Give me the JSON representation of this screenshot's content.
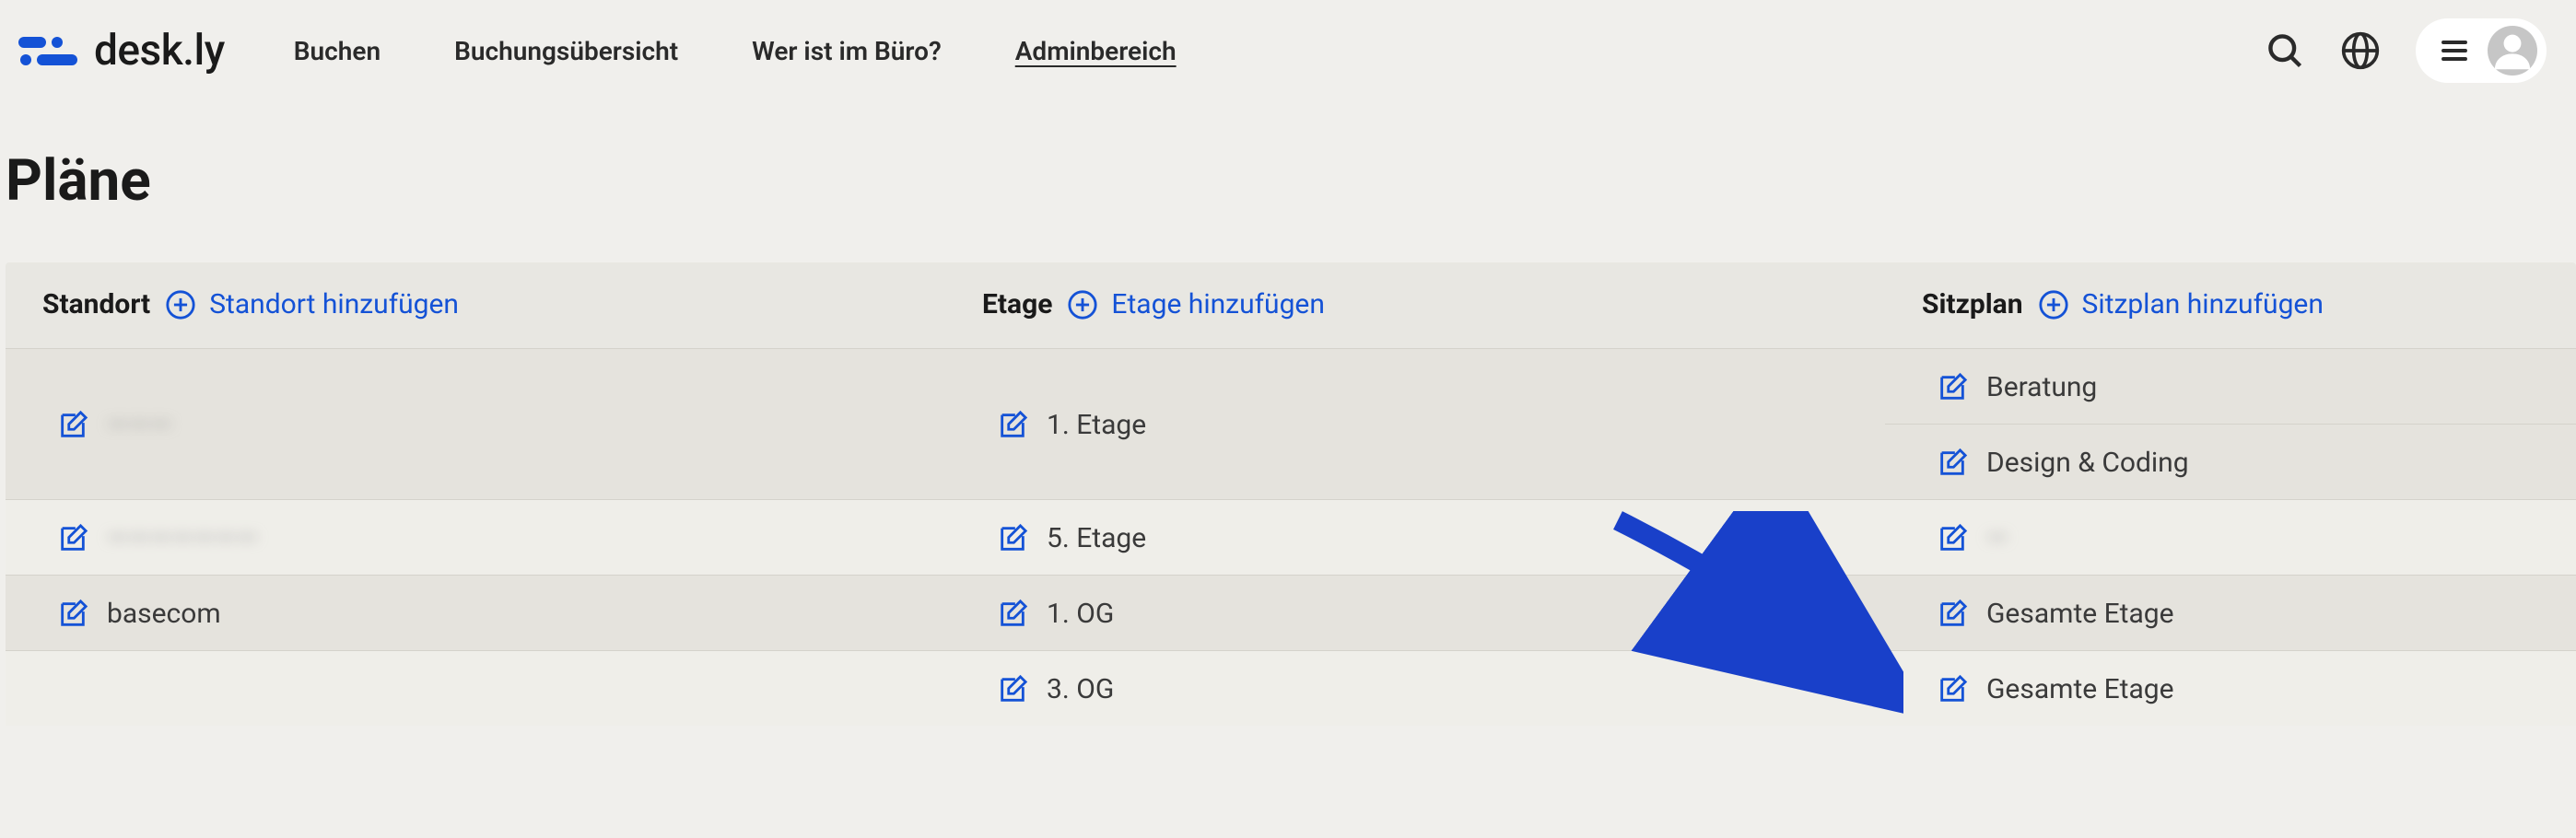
{
  "brand": {
    "text": "desk.ly"
  },
  "nav": {
    "items": [
      {
        "label": "Buchen"
      },
      {
        "label": "Buchungsübersicht"
      },
      {
        "label": "Wer ist im Büro?"
      },
      {
        "label": "Adminbereich",
        "active": true
      }
    ]
  },
  "page": {
    "title": "Pläne"
  },
  "columns": {
    "standort": {
      "label": "Standort",
      "add": "Standort hinzufügen"
    },
    "etage": {
      "label": "Etage",
      "add": "Etage hinzufügen"
    },
    "sitzplan": {
      "label": "Sitzplan",
      "add": "Sitzplan hinzufügen"
    }
  },
  "rows": [
    {
      "standort": {
        "text": "———",
        "blurred": true
      },
      "etage": [
        {
          "text": "1. Etage"
        }
      ],
      "sitzplan": [
        {
          "text": "Beratung"
        },
        {
          "text": "Design & Coding"
        }
      ]
    },
    {
      "standort": {
        "text": "———————",
        "blurred": true
      },
      "etage": [
        {
          "text": "5. Etage"
        }
      ],
      "sitzplan": [
        {
          "text": "—",
          "blurred": true
        }
      ]
    },
    {
      "standort": {
        "text": "basecom"
      },
      "etage": [
        {
          "text": "1. OG"
        }
      ],
      "sitzplan": [
        {
          "text": "Gesamte Etage"
        }
      ]
    },
    {
      "standort": {
        "text": ""
      },
      "etage": [
        {
          "text": "3. OG"
        }
      ],
      "sitzplan": [
        {
          "text": "Gesamte Etage"
        }
      ]
    }
  ]
}
